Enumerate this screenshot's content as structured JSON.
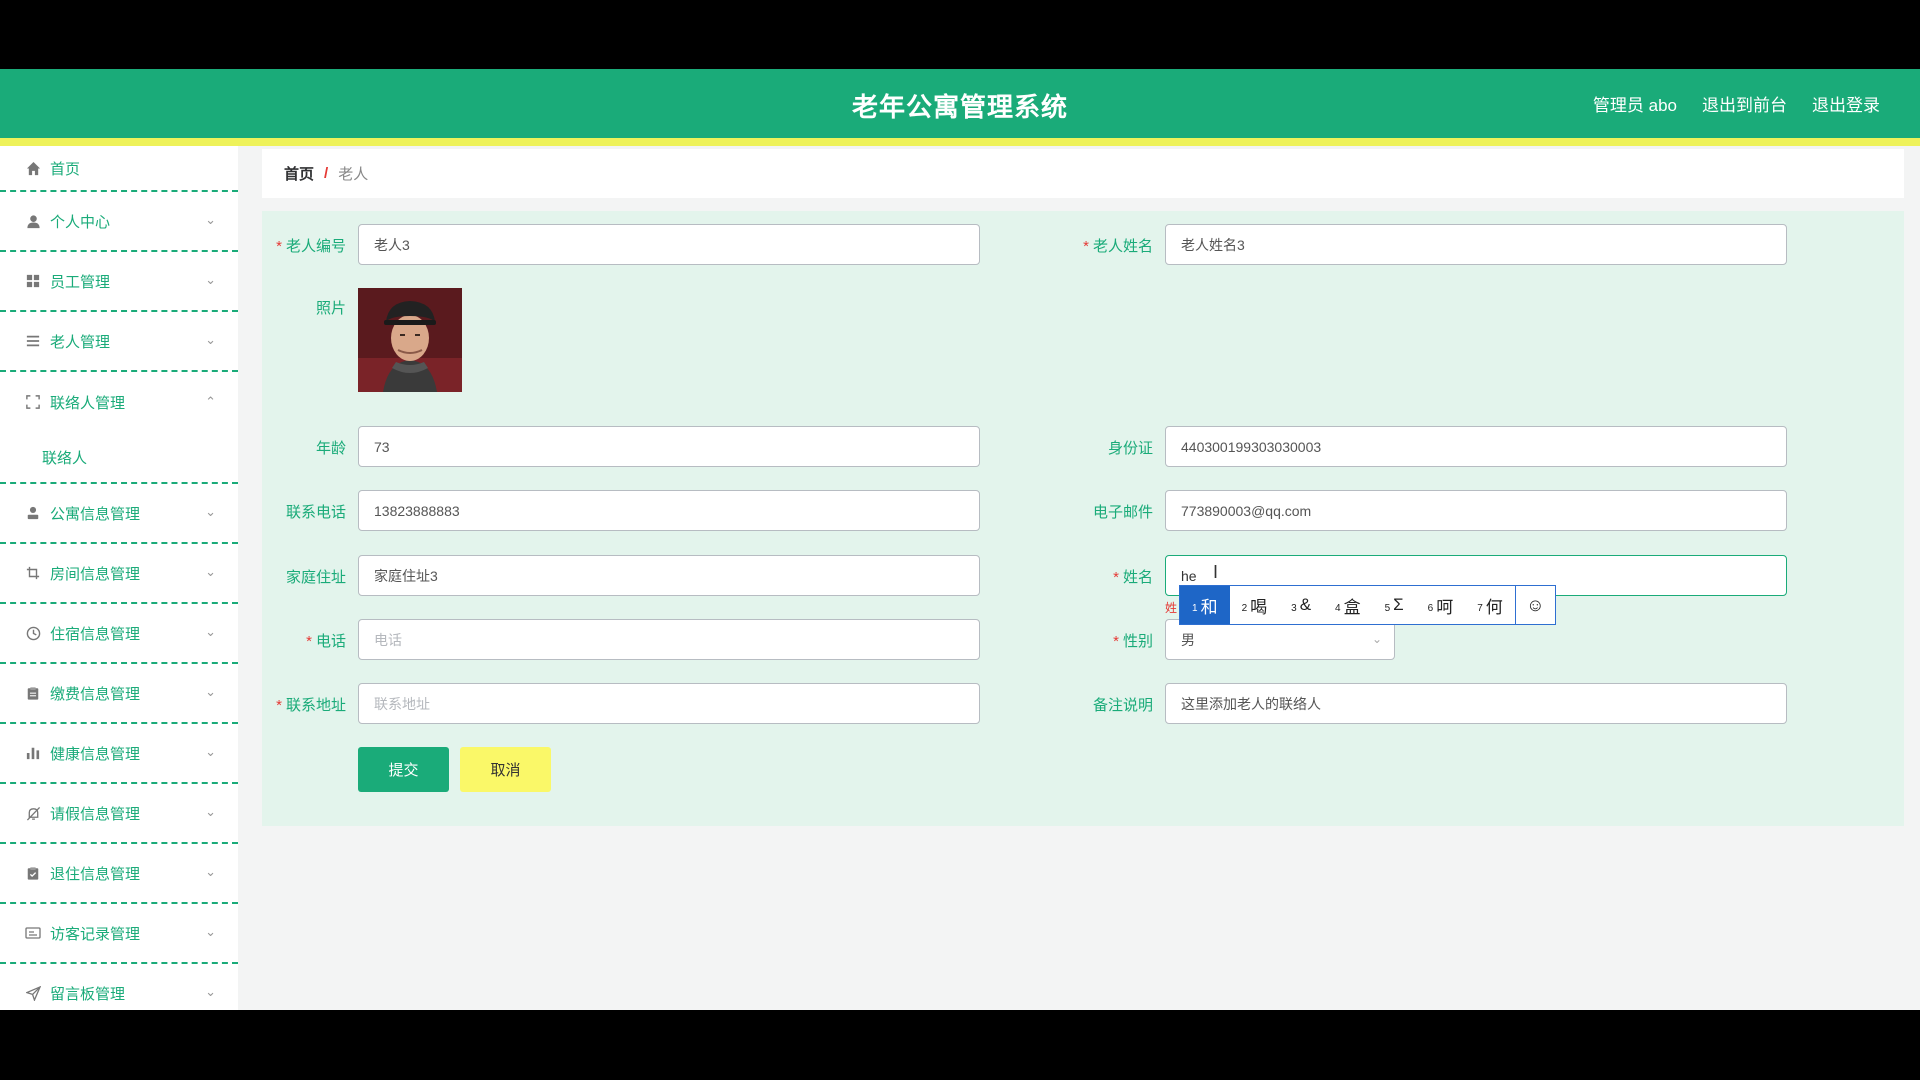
{
  "header": {
    "title": "老年公寓管理系统",
    "user": "管理员 abo",
    "front_link": "退出到前台",
    "logout_link": "退出登录"
  },
  "sidebar": {
    "items": [
      {
        "label": "首页",
        "icon": "home-icon"
      },
      {
        "label": "个人中心",
        "icon": "user-icon"
      },
      {
        "label": "员工管理",
        "icon": "grid-icon"
      },
      {
        "label": "老人管理",
        "icon": "list-icon"
      },
      {
        "label": "联络人管理",
        "icon": "expand-icon"
      },
      {
        "label": "公寓信息管理",
        "icon": "person-icon"
      },
      {
        "label": "房间信息管理",
        "icon": "crop-icon"
      },
      {
        "label": "住宿信息管理",
        "icon": "clock-icon"
      },
      {
        "label": "缴费信息管理",
        "icon": "clipboard-icon"
      },
      {
        "label": "健康信息管理",
        "icon": "bar-chart-icon"
      },
      {
        "label": "请假信息管理",
        "icon": "bell-off-icon"
      },
      {
        "label": "退住信息管理",
        "icon": "checklist-icon"
      },
      {
        "label": "访客记录管理",
        "icon": "card-icon"
      },
      {
        "label": "留言板管理",
        "icon": "send-icon"
      }
    ],
    "submenu_label": "联络人"
  },
  "breadcrumb": {
    "home": "首页",
    "separator": "/",
    "current": "老人"
  },
  "form": {
    "elder_no_label": "老人编号",
    "elder_no_value": "老人3",
    "elder_name_label": "老人姓名",
    "elder_name_value": "老人姓名3",
    "photo_label": "照片",
    "age_label": "年龄",
    "age_value": "73",
    "id_card_label": "身份证",
    "id_card_value": "440300199303030003",
    "phone_label": "联系电话",
    "phone_value": "13823888883",
    "email_label": "电子邮件",
    "email_value": "773890003@qq.com",
    "address_label": "家庭住址",
    "address_value": "家庭住址3",
    "name_label": "姓名",
    "name_value": "he",
    "tel_label": "电话",
    "tel_placeholder": "电话",
    "gender_label": "性别",
    "gender_value": "男",
    "contact_address_label": "联系地址",
    "contact_address_placeholder": "联系地址",
    "remark_label": "备注说明",
    "remark_value": "这里添加老人的联络人",
    "required_mark": "*",
    "name_error_fragment": "姓"
  },
  "buttons": {
    "submit": "提交",
    "cancel": "取消"
  },
  "ime": {
    "candidates": [
      {
        "num": "1",
        "text": "和"
      },
      {
        "num": "2",
        "text": "喝"
      },
      {
        "num": "3",
        "text": "&"
      },
      {
        "num": "4",
        "text": "盒"
      },
      {
        "num": "5",
        "text": "Σ"
      },
      {
        "num": "6",
        "text": "呵"
      },
      {
        "num": "7",
        "text": "何"
      }
    ],
    "emoji": "☺"
  },
  "colors": {
    "primary": "#1aab79",
    "stripe": "#eef25a",
    "cancel": "#faf868",
    "required": "#e53935"
  }
}
